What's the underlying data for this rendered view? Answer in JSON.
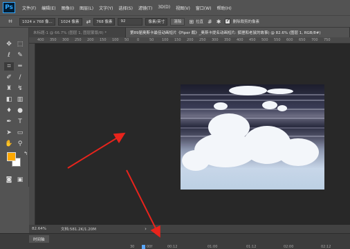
{
  "app": {
    "logo": "Ps"
  },
  "menu": [
    "文件(F)",
    "编辑(E)",
    "图像(I)",
    "图层(L)",
    "文字(Y)",
    "选择(S)",
    "滤镜(T)",
    "3D(D)",
    "视图(V)",
    "窗口(W)",
    "帮助(H)"
  ],
  "options": {
    "preset": "1024 x 768 像...",
    "width": "1024 像素",
    "height": "768 像素",
    "resolution": "92",
    "units": "像素/英寸",
    "clear_label": "拉直",
    "delete_cropped_label": "删除裁剪的像素"
  },
  "tabs": [
    "未标题-1 @ 66.7% (图层 1, 图层蒙版/8) *",
    "第89届奥斯卡最佳动画短片《Piper 鹬》_奥斯卡提名动画短片: 狐狸和老鼠的故事) @ 82.6% (图层 1, RGB/8#)"
  ],
  "ruler": [
    "400",
    "350",
    "300",
    "250",
    "200",
    "150",
    "100",
    "50",
    "0",
    "50",
    "100",
    "150",
    "200",
    "250",
    "300",
    "350",
    "400",
    "450",
    "500",
    "550",
    "600",
    "650",
    "700",
    "750"
  ],
  "status": {
    "zoom": "82.64%",
    "doc": "文档:581.2K/1.20M",
    "chevron": "›"
  },
  "timeline": {
    "tab_label": "时间轴",
    "marks": [
      "30",
      "00f",
      "00:12",
      "01:00",
      "01:12",
      "02:00",
      "02:12"
    ]
  },
  "colors": {
    "foreground": "#ffa800",
    "background": "#ffffff",
    "arrow": "#e8241c"
  }
}
